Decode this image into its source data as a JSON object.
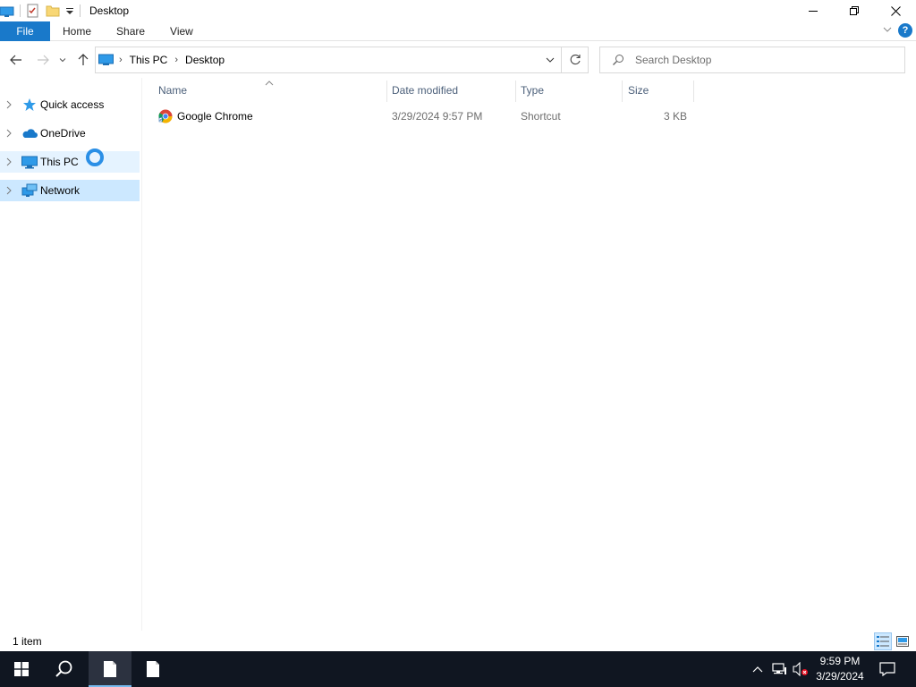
{
  "window": {
    "title": "Desktop",
    "quick_access_toolbar": [
      "computer-icon",
      "properties-icon",
      "new-folder-icon",
      "customize-dropdown-icon"
    ]
  },
  "ribbon": {
    "tabs": [
      "File",
      "Home",
      "Share",
      "View"
    ]
  },
  "address_bar": {
    "breadcrumbs": [
      "This PC",
      "Desktop"
    ]
  },
  "search": {
    "placeholder": "Search Desktop"
  },
  "nav_pane": {
    "items": [
      {
        "label": "Quick access",
        "icon": "star-icon"
      },
      {
        "label": "OneDrive",
        "icon": "cloud-icon"
      },
      {
        "label": "This PC",
        "icon": "computer-icon"
      },
      {
        "label": "Network",
        "icon": "network-icon"
      }
    ]
  },
  "file_list": {
    "columns": [
      "Name",
      "Date modified",
      "Type",
      "Size"
    ],
    "rows": [
      {
        "name": "Google Chrome",
        "date_modified": "3/29/2024 9:57 PM",
        "type": "Shortcut",
        "size": "3 KB",
        "icon": "chrome-icon"
      }
    ]
  },
  "status_bar": {
    "item_count": "1 item"
  },
  "taskbar": {
    "time": "9:59 PM",
    "date": "3/29/2024"
  },
  "colors": {
    "accent": "#1979ca",
    "selection": "#cce8ff",
    "hover": "#e5f3ff",
    "taskbar": "#101621"
  }
}
